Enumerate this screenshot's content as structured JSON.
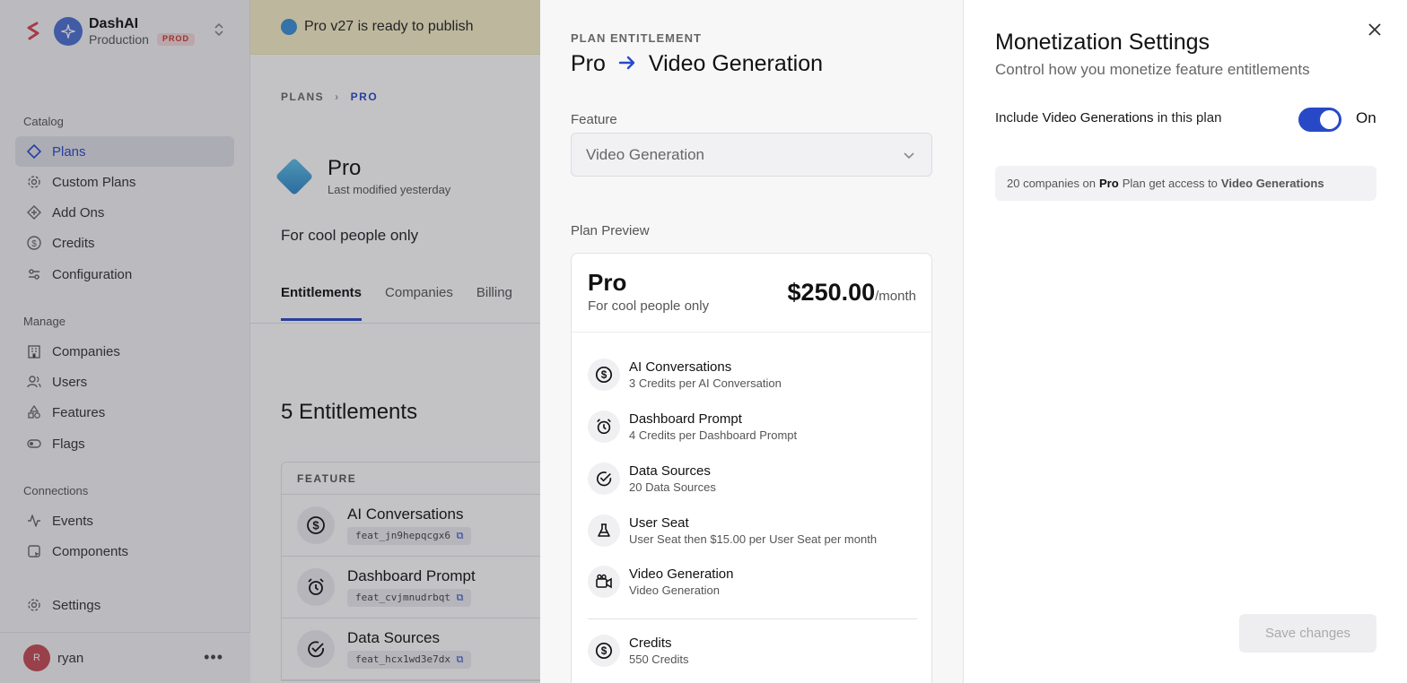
{
  "workspace": {
    "name": "DashAI",
    "environment": "Production",
    "badge": "PROD"
  },
  "sidebar": {
    "sections": [
      {
        "title": "Catalog"
      },
      {
        "title": "Manage"
      },
      {
        "title": "Connections"
      }
    ],
    "catalog": [
      {
        "label": "Plans",
        "icon": "diamond-icon",
        "active": true
      },
      {
        "label": "Custom Plans",
        "icon": "gear-icon"
      },
      {
        "label": "Add Ons",
        "icon": "diamond-plus-icon"
      },
      {
        "label": "Credits",
        "icon": "dollar-circle-icon"
      },
      {
        "label": "Configuration",
        "icon": "sliders-icon"
      }
    ],
    "manage": [
      {
        "label": "Companies",
        "icon": "building-icon"
      },
      {
        "label": "Users",
        "icon": "users-icon"
      },
      {
        "label": "Features",
        "icon": "shapes-icon"
      },
      {
        "label": "Flags",
        "icon": "toggle-icon"
      }
    ],
    "connections": [
      {
        "label": "Events",
        "icon": "activity-icon"
      },
      {
        "label": "Components",
        "icon": "component-icon"
      }
    ],
    "settings": {
      "label": "Settings",
      "icon": "gear-icon"
    },
    "user": {
      "initial": "R",
      "name": "ryan"
    }
  },
  "main": {
    "publish_banner": "Pro v27 is ready to publish",
    "breadcrumb": {
      "root": "PLANS",
      "current": "PRO"
    },
    "plan": {
      "name": "Pro",
      "modified": "Last modified yesterday",
      "description": "For cool people only"
    },
    "tabs": [
      "Entitlements",
      "Companies",
      "Billing"
    ],
    "entitlements_title": "5 Entitlements",
    "table_header": "FEATURE",
    "rows": [
      {
        "name": "AI Conversations",
        "id": "feat_jn9hepqcgx6",
        "icon": "dollar-circle-icon"
      },
      {
        "name": "Dashboard Prompt",
        "id": "feat_cvjmnudrbqt",
        "icon": "alarm-clock-icon"
      },
      {
        "name": "Data Sources",
        "id": "feat_hcx1wd3e7dx",
        "icon": "check-circle-icon"
      }
    ]
  },
  "middle_panel": {
    "eyebrow": "PLAN ENTITLEMENT",
    "title_from": "Pro",
    "title_to": "Video Generation",
    "feature_label": "Feature",
    "feature_value": "Video Generation",
    "preview_label": "Plan Preview",
    "preview": {
      "name": "Pro",
      "description": "For cool people only",
      "price": "$250.00",
      "period": "/month",
      "items": [
        {
          "title": "AI Conversations",
          "sub": "3 Credits per AI Conversation",
          "icon": "dollar-circle-icon"
        },
        {
          "title": "Dashboard Prompt",
          "sub": "4 Credits per Dashboard Prompt",
          "icon": "alarm-clock-icon"
        },
        {
          "title": "Data Sources",
          "sub": "20 Data Sources",
          "icon": "check-circle-icon"
        },
        {
          "title": "User Seat",
          "sub": "User Seat then $15.00 per User Seat per month",
          "icon": "flask-icon"
        },
        {
          "title": "Video Generation",
          "sub": "Video Generation",
          "icon": "video-camera-icon"
        }
      ],
      "credits": {
        "title": "Credits",
        "sub": "550 Credits",
        "icon": "dollar-circle-icon"
      }
    }
  },
  "right_panel": {
    "title": "Monetization Settings",
    "subtitle": "Control how you monetize feature entitlements",
    "include_prefix": "Include",
    "include_feature": "Video Generations",
    "include_suffix": "in this plan",
    "toggle_on": true,
    "toggle_label": "On",
    "info_prefix": "20 companies on",
    "info_plan": "Pro",
    "info_middle": "Plan get access to",
    "info_feature": "Video Generations",
    "save_label": "Save changes"
  },
  "colors": {
    "accent": "#2849c7",
    "banner": "#f7f0c7",
    "brand": "#d8434e"
  }
}
